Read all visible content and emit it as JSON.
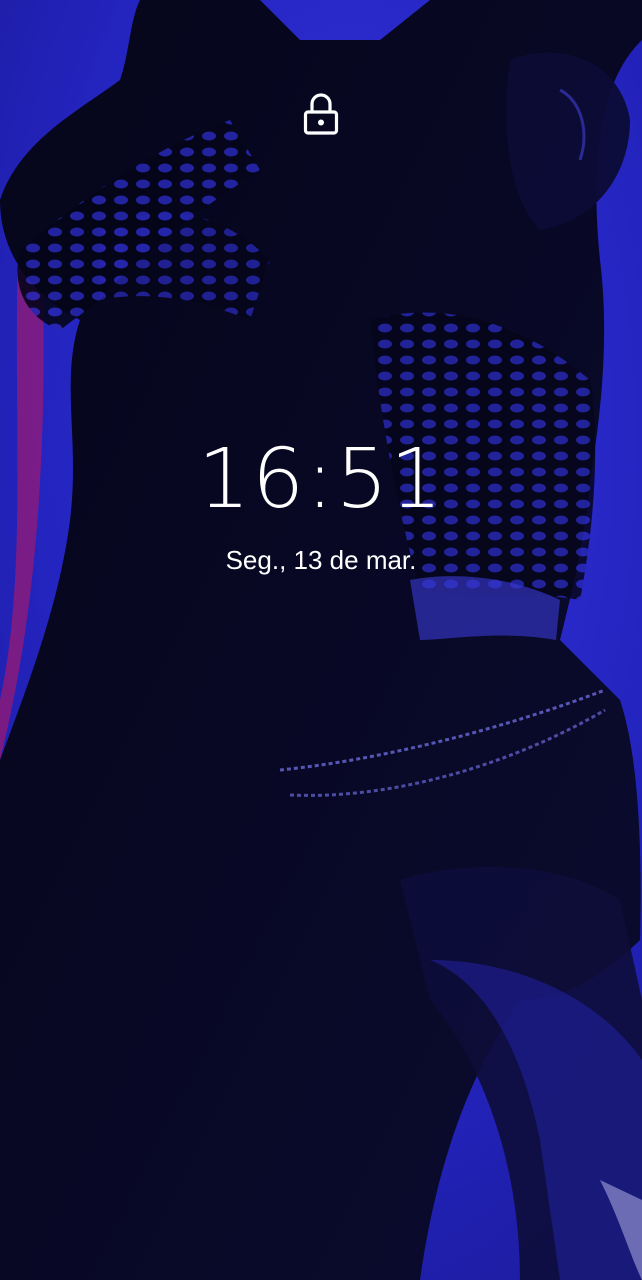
{
  "lock_screen": {
    "time": "16:51",
    "date": "Seg., 13 de mar."
  },
  "icons": {
    "lock": "padlock-icon"
  },
  "colors": {
    "wallpaper_blue": "#2a2ad0",
    "wallpaper_dark": "#05051e",
    "text": "#ffffff"
  }
}
